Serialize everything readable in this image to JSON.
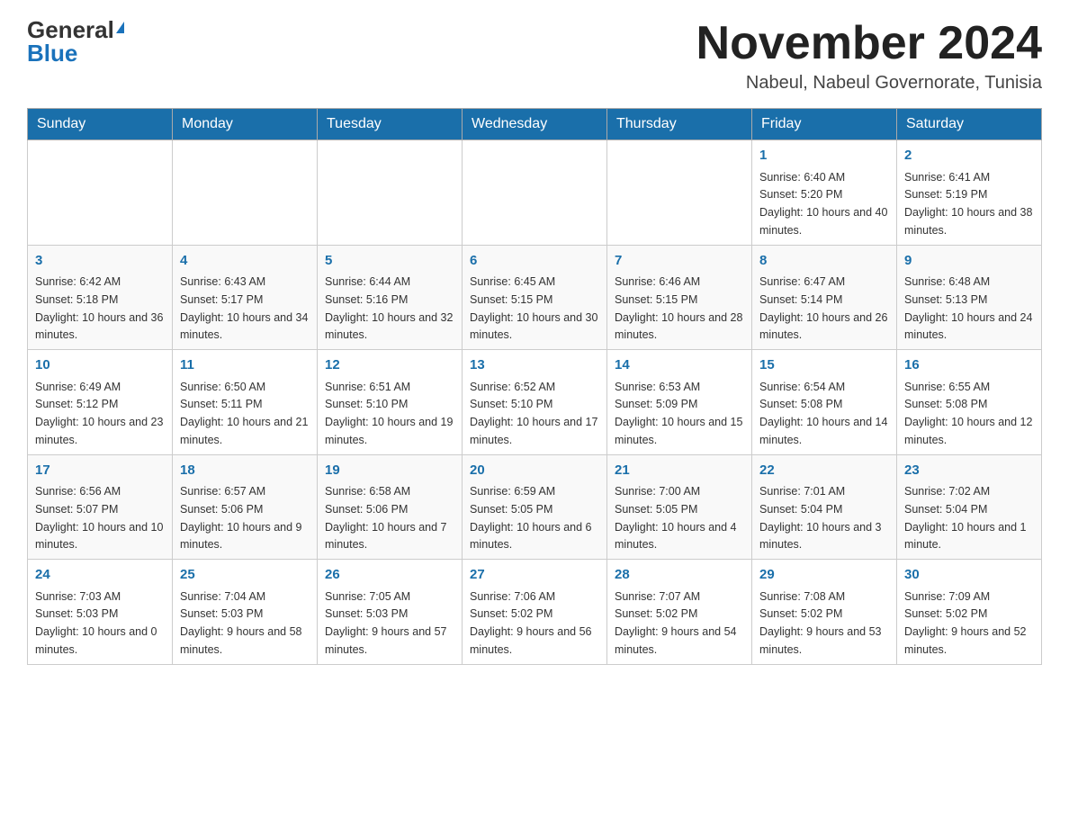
{
  "header": {
    "logo_general": "General",
    "logo_blue": "Blue",
    "month_title": "November 2024",
    "location": "Nabeul, Nabeul Governorate, Tunisia"
  },
  "days_of_week": [
    "Sunday",
    "Monday",
    "Tuesday",
    "Wednesday",
    "Thursday",
    "Friday",
    "Saturday"
  ],
  "weeks": [
    [
      {
        "day": "",
        "info": ""
      },
      {
        "day": "",
        "info": ""
      },
      {
        "day": "",
        "info": ""
      },
      {
        "day": "",
        "info": ""
      },
      {
        "day": "",
        "info": ""
      },
      {
        "day": "1",
        "info": "Sunrise: 6:40 AM\nSunset: 5:20 PM\nDaylight: 10 hours and 40 minutes."
      },
      {
        "day": "2",
        "info": "Sunrise: 6:41 AM\nSunset: 5:19 PM\nDaylight: 10 hours and 38 minutes."
      }
    ],
    [
      {
        "day": "3",
        "info": "Sunrise: 6:42 AM\nSunset: 5:18 PM\nDaylight: 10 hours and 36 minutes."
      },
      {
        "day": "4",
        "info": "Sunrise: 6:43 AM\nSunset: 5:17 PM\nDaylight: 10 hours and 34 minutes."
      },
      {
        "day": "5",
        "info": "Sunrise: 6:44 AM\nSunset: 5:16 PM\nDaylight: 10 hours and 32 minutes."
      },
      {
        "day": "6",
        "info": "Sunrise: 6:45 AM\nSunset: 5:15 PM\nDaylight: 10 hours and 30 minutes."
      },
      {
        "day": "7",
        "info": "Sunrise: 6:46 AM\nSunset: 5:15 PM\nDaylight: 10 hours and 28 minutes."
      },
      {
        "day": "8",
        "info": "Sunrise: 6:47 AM\nSunset: 5:14 PM\nDaylight: 10 hours and 26 minutes."
      },
      {
        "day": "9",
        "info": "Sunrise: 6:48 AM\nSunset: 5:13 PM\nDaylight: 10 hours and 24 minutes."
      }
    ],
    [
      {
        "day": "10",
        "info": "Sunrise: 6:49 AM\nSunset: 5:12 PM\nDaylight: 10 hours and 23 minutes."
      },
      {
        "day": "11",
        "info": "Sunrise: 6:50 AM\nSunset: 5:11 PM\nDaylight: 10 hours and 21 minutes."
      },
      {
        "day": "12",
        "info": "Sunrise: 6:51 AM\nSunset: 5:10 PM\nDaylight: 10 hours and 19 minutes."
      },
      {
        "day": "13",
        "info": "Sunrise: 6:52 AM\nSunset: 5:10 PM\nDaylight: 10 hours and 17 minutes."
      },
      {
        "day": "14",
        "info": "Sunrise: 6:53 AM\nSunset: 5:09 PM\nDaylight: 10 hours and 15 minutes."
      },
      {
        "day": "15",
        "info": "Sunrise: 6:54 AM\nSunset: 5:08 PM\nDaylight: 10 hours and 14 minutes."
      },
      {
        "day": "16",
        "info": "Sunrise: 6:55 AM\nSunset: 5:08 PM\nDaylight: 10 hours and 12 minutes."
      }
    ],
    [
      {
        "day": "17",
        "info": "Sunrise: 6:56 AM\nSunset: 5:07 PM\nDaylight: 10 hours and 10 minutes."
      },
      {
        "day": "18",
        "info": "Sunrise: 6:57 AM\nSunset: 5:06 PM\nDaylight: 10 hours and 9 minutes."
      },
      {
        "day": "19",
        "info": "Sunrise: 6:58 AM\nSunset: 5:06 PM\nDaylight: 10 hours and 7 minutes."
      },
      {
        "day": "20",
        "info": "Sunrise: 6:59 AM\nSunset: 5:05 PM\nDaylight: 10 hours and 6 minutes."
      },
      {
        "day": "21",
        "info": "Sunrise: 7:00 AM\nSunset: 5:05 PM\nDaylight: 10 hours and 4 minutes."
      },
      {
        "day": "22",
        "info": "Sunrise: 7:01 AM\nSunset: 5:04 PM\nDaylight: 10 hours and 3 minutes."
      },
      {
        "day": "23",
        "info": "Sunrise: 7:02 AM\nSunset: 5:04 PM\nDaylight: 10 hours and 1 minute."
      }
    ],
    [
      {
        "day": "24",
        "info": "Sunrise: 7:03 AM\nSunset: 5:03 PM\nDaylight: 10 hours and 0 minutes."
      },
      {
        "day": "25",
        "info": "Sunrise: 7:04 AM\nSunset: 5:03 PM\nDaylight: 9 hours and 58 minutes."
      },
      {
        "day": "26",
        "info": "Sunrise: 7:05 AM\nSunset: 5:03 PM\nDaylight: 9 hours and 57 minutes."
      },
      {
        "day": "27",
        "info": "Sunrise: 7:06 AM\nSunset: 5:02 PM\nDaylight: 9 hours and 56 minutes."
      },
      {
        "day": "28",
        "info": "Sunrise: 7:07 AM\nSunset: 5:02 PM\nDaylight: 9 hours and 54 minutes."
      },
      {
        "day": "29",
        "info": "Sunrise: 7:08 AM\nSunset: 5:02 PM\nDaylight: 9 hours and 53 minutes."
      },
      {
        "day": "30",
        "info": "Sunrise: 7:09 AM\nSunset: 5:02 PM\nDaylight: 9 hours and 52 minutes."
      }
    ]
  ]
}
